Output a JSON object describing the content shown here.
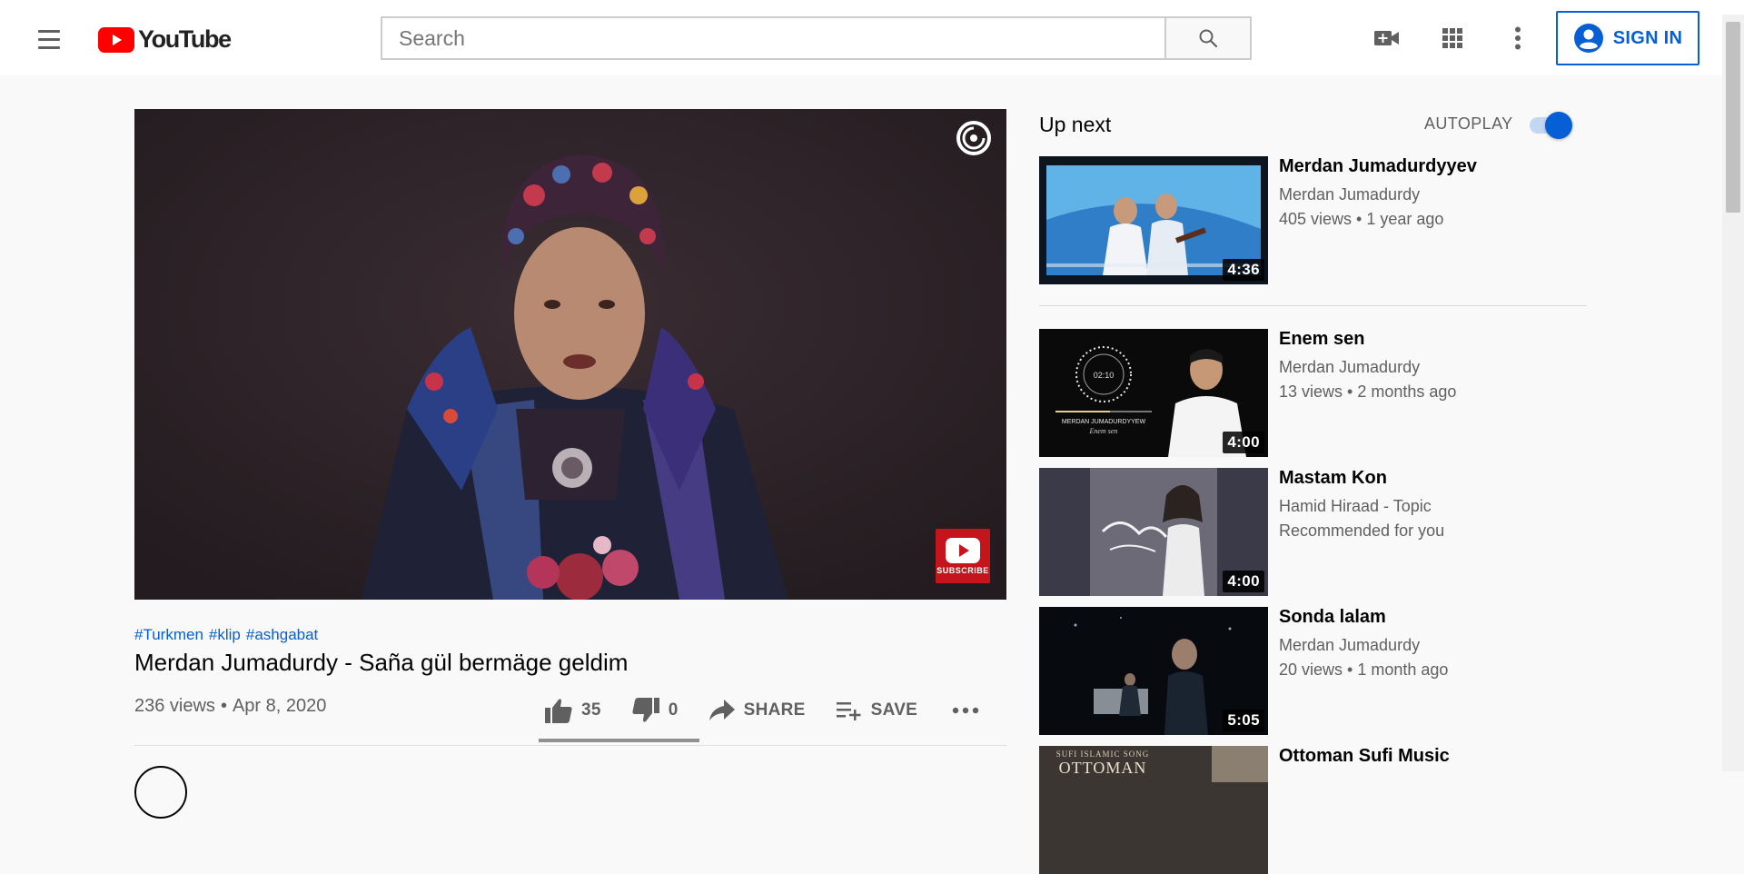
{
  "header": {
    "logo_text": "YouTube",
    "search_placeholder": "Search",
    "signin_label": "SIGN IN",
    "icons": [
      "menu-icon",
      "youtube-logo",
      "search-icon",
      "create-video-icon",
      "apps-grid-icon",
      "more-vert-icon",
      "account-circle-icon"
    ]
  },
  "video": {
    "hashtags": [
      "#Turkmen",
      "#klip",
      "#ashgabat"
    ],
    "title": "Merdan Jumadurdy - Saña gül bermäge geldim",
    "views": "236 views",
    "separator": "•",
    "date": "Apr 8, 2020",
    "likes": "35",
    "dislikes": "0",
    "share_label": "SHARE",
    "save_label": "SAVE",
    "watermark_label": "SUBSCRIBE"
  },
  "upnext": {
    "title": "Up next",
    "autoplay_label": "AUTOPLAY",
    "autoplay_on": true,
    "items": [
      {
        "title": "Merdan Jumadurdyyev",
        "channel": "Merdan Jumadurdy",
        "meta": "405 views • 1 year ago",
        "duration": "4:36"
      },
      {
        "title": "Enem sen",
        "channel": "Merdan Jumadurdy",
        "meta": "13 views • 2 months ago",
        "duration": "4:00",
        "thumb_text": [
          "02:10",
          "MERDAN JUMADURDYYEW",
          "Enem sen"
        ]
      },
      {
        "title": "Mastam Kon",
        "channel": "Hamid Hiraad - Topic",
        "meta": "Recommended for you",
        "duration": "4:00"
      },
      {
        "title": "Sonda lalam",
        "channel": "Merdan Jumadurdy",
        "meta": "20 views • 1 month ago",
        "duration": "5:05"
      },
      {
        "title": "Ottoman Sufi Music",
        "channel": "",
        "meta": "",
        "duration": "",
        "thumb_text": [
          "SUFI ISLAMIC SONG",
          "OTTOMAN"
        ]
      }
    ]
  },
  "colors": {
    "accent_blue": "#065fd4",
    "youtube_red": "#ff0000",
    "text_primary": "#030303",
    "text_secondary": "#606060"
  }
}
